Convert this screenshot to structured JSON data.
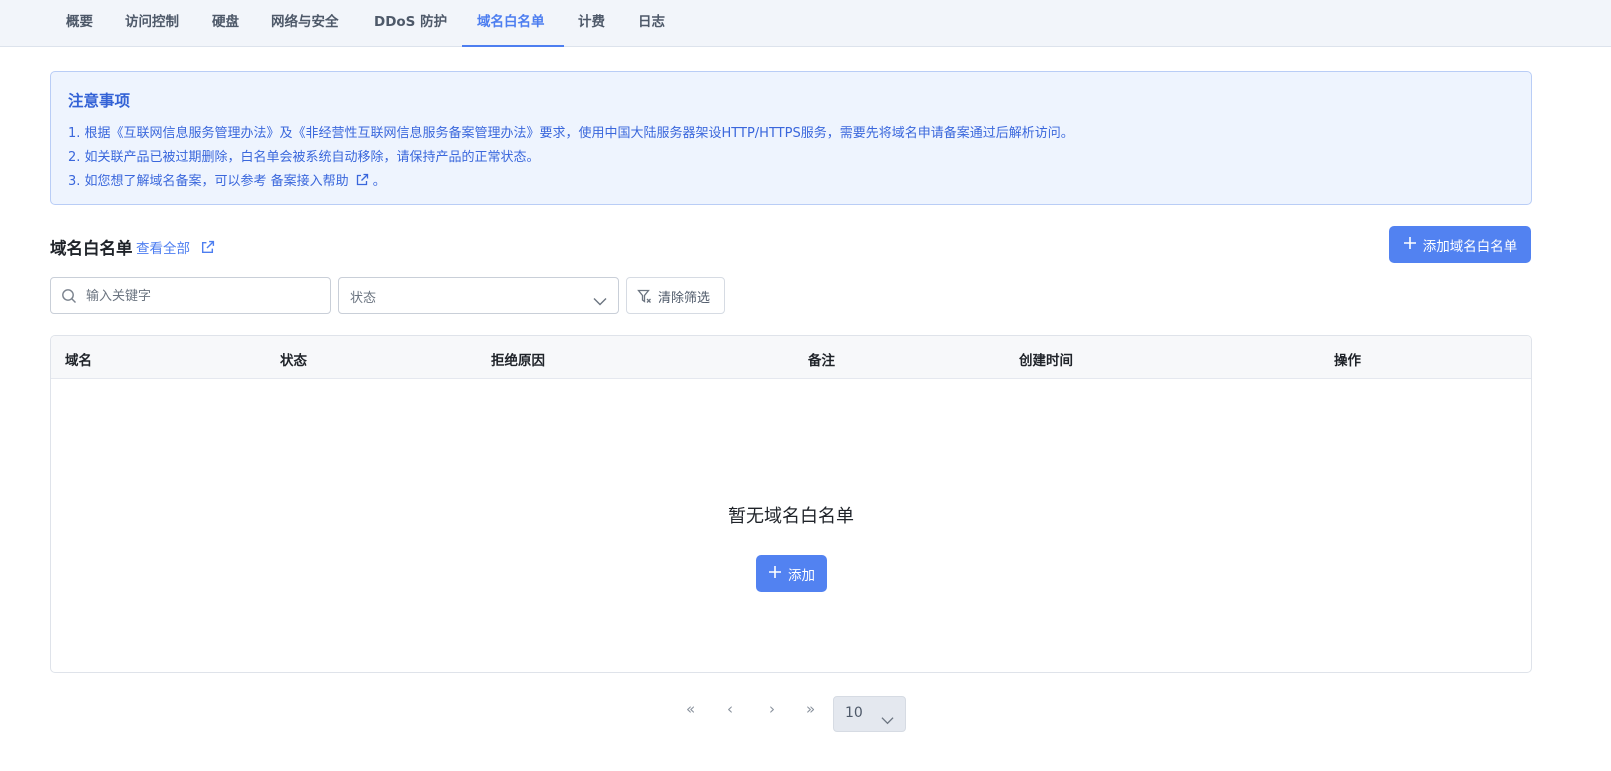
{
  "tabs": [
    {
      "label": "概要"
    },
    {
      "label": "访问控制"
    },
    {
      "label": "硬盘"
    },
    {
      "label": "网络与安全"
    },
    {
      "label": "DDoS 防护"
    },
    {
      "label": "域名白名单",
      "active": true
    },
    {
      "label": "计费"
    },
    {
      "label": "日志"
    }
  ],
  "notice": {
    "title": "注意事项",
    "line1": "1. 根据《互联网信息服务管理办法》及《非经营性互联网信息服务备案管理办法》要求，使用中国大陆服务器架设HTTP/HTTPS服务，需要先将域名申请备案通过后解析访问。",
    "line2": "2. 如关联产品已被过期删除，白名单会被系统自动移除，请保持产品的正常状态。",
    "line3_prefix": "3. 如您想了解域名备案，可以参考 ",
    "line3_link": "备案接入帮助",
    "line3_suffix": "。"
  },
  "section": {
    "title": "域名白名单",
    "view_all": "查看全部",
    "add_button": "添加域名白名单"
  },
  "filters": {
    "search_placeholder": "输入关键字",
    "status_placeholder": "状态",
    "clear_label": "清除筛选"
  },
  "table": {
    "columns": [
      "域名",
      "状态",
      "拒绝原因",
      "备注",
      "创建时间",
      "操作"
    ],
    "empty_text": "暂无域名白名单",
    "empty_add": "添加"
  },
  "pagination": {
    "first": "«",
    "prev": "‹",
    "next": "›",
    "last": "»",
    "page_size": "10"
  },
  "colors": {
    "accent": "#4d7ef0",
    "primary_button": "#5282f1",
    "notice_bg": "#eef4fe",
    "tabbar_bg": "#f2f5fa"
  }
}
